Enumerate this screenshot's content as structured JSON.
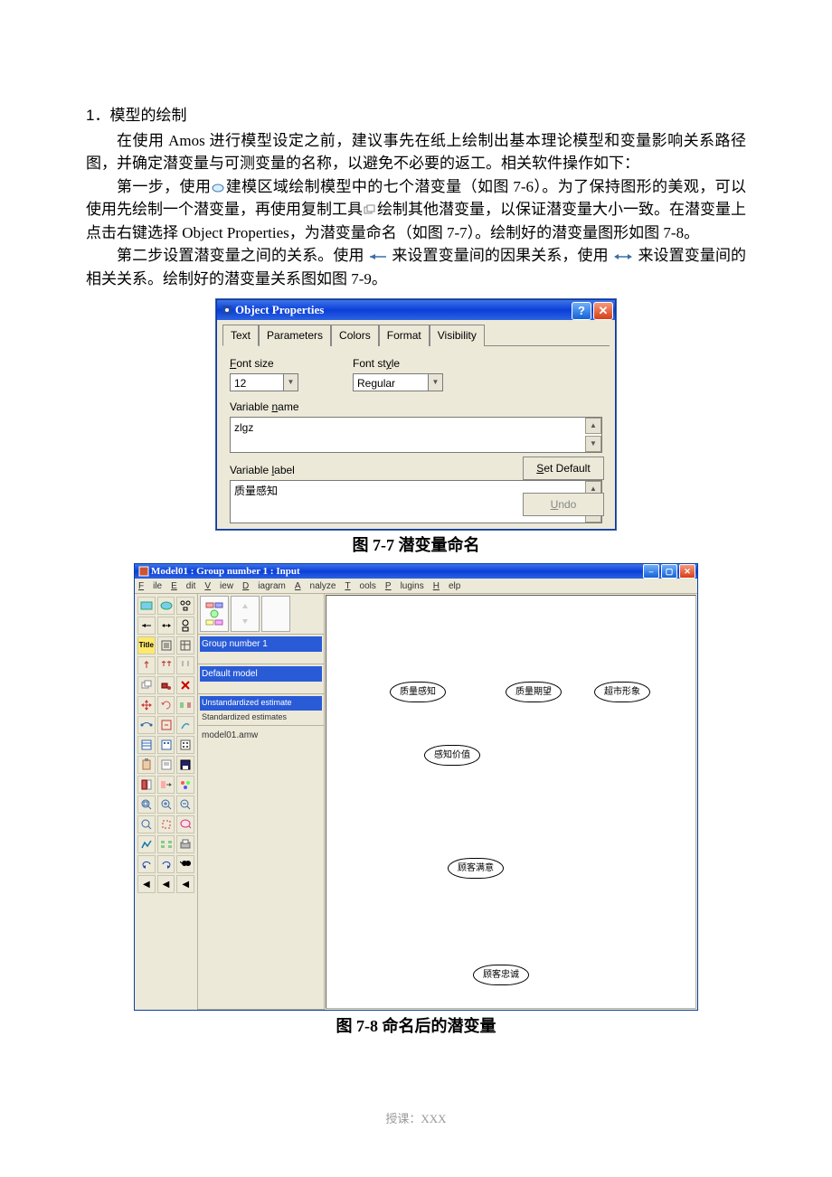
{
  "heading": "1．模型的绘制",
  "para1": "在使用 Amos 进行模型设定之前，建议事先在纸上绘制出基本理论模型和变量影响关系路径图，并确定潜变量与可测变量的名称，以避免不必要的返工。相关软件操作如下：",
  "para2a": "第一步，使用",
  "para2b": "建模区域绘制模型中的七个潜变量（如图 7-6）。为了保持图形的美观，可以使用先绘制一个潜变量，再使用复制工具",
  "para2c": "绘制其他潜变量，以保证潜变量大小一致。在潜变量上点击右键选择 Object Properties，为潜变量命名（如图 7-7）。绘制好的潜变量图形如图 7-8。",
  "para3a": "第二步设置潜变量之间的关系。使用",
  "para3b": "来设置变量间的因果关系，使用",
  "para3c": "来设置变量间的相关关系。绘制好的潜变量关系图如图 7-9。",
  "caption1": "图 7-7   潜变量命名",
  "caption2": "图 7-8   命名后的潜变量",
  "footer": "授课：XXX",
  "dialog": {
    "title": "Object Properties",
    "tabs": [
      "Text",
      "Parameters",
      "Colors",
      "Format",
      "Visibility"
    ],
    "font_size_label": "Font size",
    "font_style_label": "Font style",
    "font_size_value": "12",
    "font_style_value": "Regular",
    "var_name_label": "Variable name",
    "var_name_value": "zlgz",
    "var_label_label": "Variable label",
    "var_label_value": "质量感知",
    "set_default": "Set Default",
    "undo": "Undo"
  },
  "amos": {
    "title": "Model01 : Group number 1 : Input",
    "menu": [
      "File",
      "Edit",
      "View",
      "Diagram",
      "Analyze",
      "Tools",
      "Plugins",
      "Help"
    ],
    "group_label": "Group number 1",
    "model_label": "Default model",
    "est1": "Unstandardized estimate",
    "est2": "Standardized estimates",
    "file": "model01.amw",
    "latents": {
      "a": "质量感知",
      "b": "质量期望",
      "c": "超市形象",
      "d": "感知价值",
      "e": "顾客满意",
      "f": "顾客忠诚"
    }
  }
}
